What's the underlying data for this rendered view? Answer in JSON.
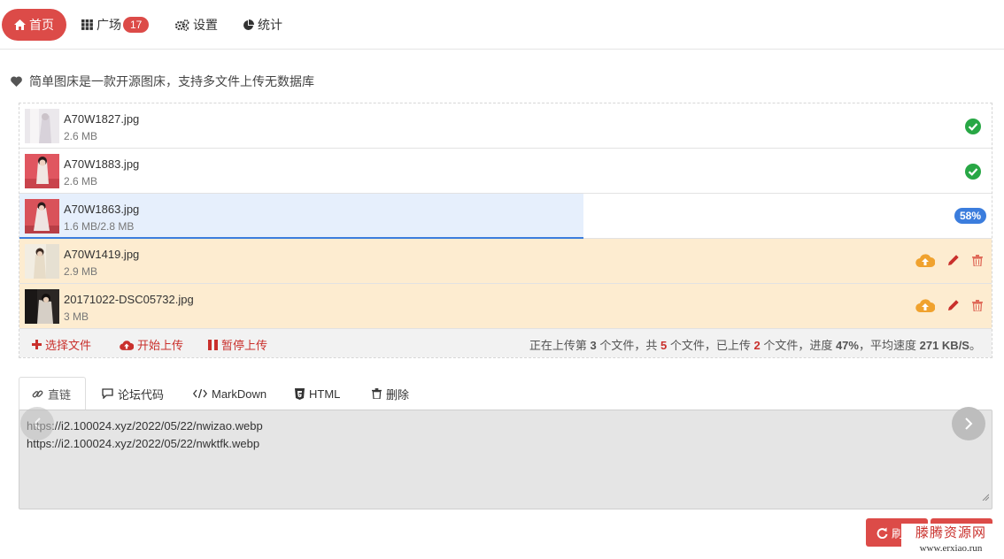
{
  "nav": {
    "items": [
      {
        "label": "首页",
        "icon": "home-icon",
        "active": true
      },
      {
        "label": "广场",
        "icon": "grid-icon",
        "badge": "17"
      },
      {
        "label": "设置",
        "icon": "gears-icon"
      },
      {
        "label": "统计",
        "icon": "pie-chart-icon"
      }
    ]
  },
  "intro": "简单图床是一款开源图床，支持多文件上传无数据库",
  "files": [
    {
      "name": "A70W1827.jpg",
      "size": "2.6 MB",
      "status": "done"
    },
    {
      "name": "A70W1883.jpg",
      "size": "2.6 MB",
      "status": "done"
    },
    {
      "name": "A70W1863.jpg",
      "size": "1.6 MB/2.8 MB",
      "status": "uploading",
      "progress": 0.58,
      "progress_label": "58%"
    },
    {
      "name": "A70W1419.jpg",
      "size": "2.9 MB",
      "status": "pending"
    },
    {
      "name": "20171022-DSC05732.jpg",
      "size": "3 MB",
      "status": "pending"
    }
  ],
  "toolbar": {
    "select": "选择文件",
    "start": "开始上传",
    "pause": "暂停上传",
    "status": {
      "p1": "正在上传第 ",
      "current": "3",
      "p2": " 个文件，共 ",
      "total": "5",
      "p3": " 个文件，已上传 ",
      "uploaded": "2",
      "p4": " 个文件，进度 ",
      "progress": "47%",
      "p5": "，平均速度 ",
      "speed": "271 KB/S",
      "p6": "。"
    }
  },
  "tabs": [
    {
      "label": "直链",
      "icon": "link-icon",
      "active": true
    },
    {
      "label": "论坛代码",
      "icon": "comment-icon"
    },
    {
      "label": "MarkDown",
      "icon": "code-icon"
    },
    {
      "label": "HTML",
      "icon": "html5-icon"
    },
    {
      "label": "删除",
      "icon": "trash-icon"
    }
  ],
  "links": [
    "https://i2.100024.xyz/2022/05/22/nwizao.webp",
    "https://i2.100024.xyz/2022/05/22/nwktfk.webp"
  ],
  "bottom": {
    "refresh": "刷"
  },
  "watermark": {
    "top": "滕腾资源网",
    "bottom": "www.erxiao.run"
  },
  "colors": {
    "accent": "#dc4b48",
    "success": "#28a745",
    "progress": "#3b7ddd",
    "pending": "#f0a22e",
    "pending_bg": "#fdecd0"
  }
}
